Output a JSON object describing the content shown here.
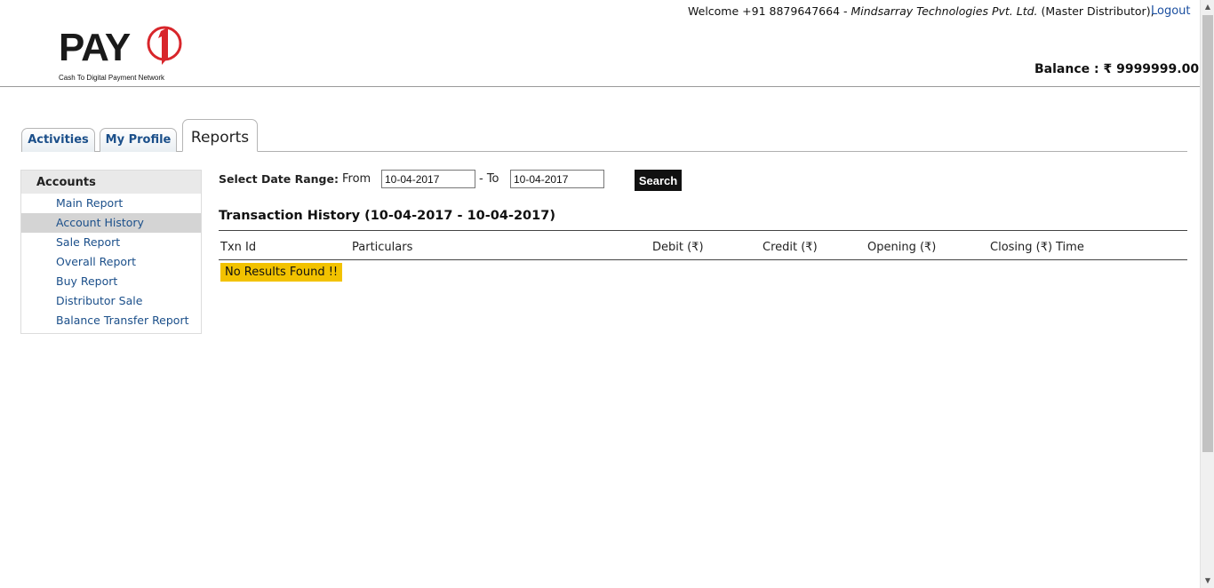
{
  "header": {
    "logo_text": "PAY",
    "logo_digit": "1",
    "logo_tagline": "Cash To Digital Payment Network",
    "welcome_prefix": "Welcome +91 8879647664 - ",
    "company": "Mindsarray Technologies Pvt. Ltd.",
    "role": " (Master Distributor),",
    "logout_label": "Logout",
    "balance_label": "Balance : ₹ 9999999.00"
  },
  "tabs": [
    {
      "label": "Activities",
      "active": false
    },
    {
      "label": "My Profile",
      "active": false
    },
    {
      "label": "Reports",
      "active": true
    }
  ],
  "sidebar": {
    "title": "Accounts",
    "items": [
      {
        "label": "Main Report",
        "selected": false
      },
      {
        "label": "Account History",
        "selected": true
      },
      {
        "label": "Sale Report",
        "selected": false
      },
      {
        "label": "Overall Report",
        "selected": false
      },
      {
        "label": "Buy Report",
        "selected": false
      },
      {
        "label": "Distributor Sale",
        "selected": false
      },
      {
        "label": "Balance Transfer Report",
        "selected": false
      }
    ]
  },
  "filter": {
    "label": "Select Date Range:",
    "from_label": "From",
    "from_value": "10-04-2017",
    "to_label": "- To",
    "to_value": "10-04-2017",
    "search_label": "Search"
  },
  "report": {
    "title": "Transaction History (10-04-2017 - 10-04-2017)",
    "columns": [
      "Txn Id",
      "Particulars",
      "Debit (₹)",
      "Credit (₹)",
      "Opening (₹)",
      "Closing (₹)",
      "Time"
    ],
    "empty_message": "No Results Found !!"
  },
  "colors": {
    "link": "#1b4f8a",
    "logo_accent": "#d8262b",
    "empty_badge": "#f2c200"
  }
}
